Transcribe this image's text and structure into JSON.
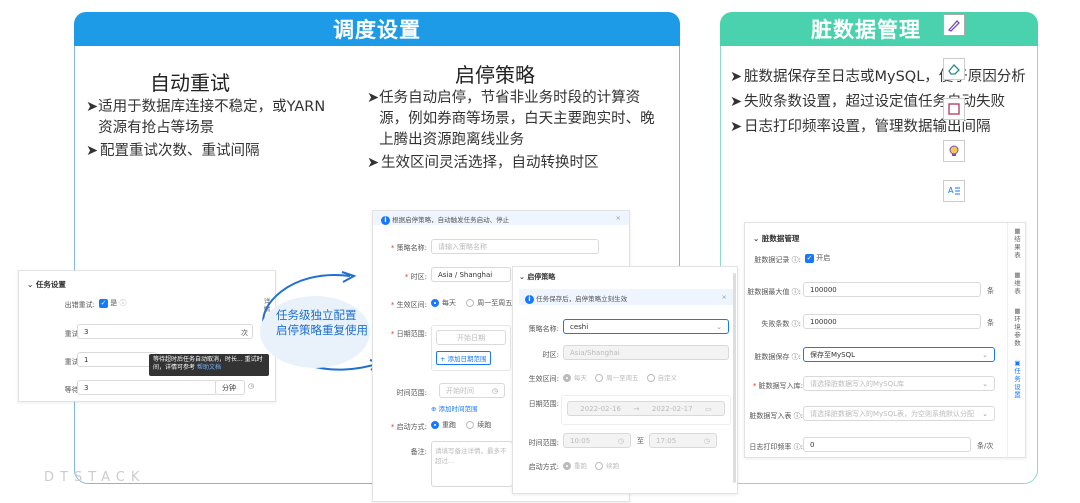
{
  "left_panel": {
    "title": "调度设置",
    "retry": {
      "title": "自动重试",
      "bullets": [
        "适用于数据库连接不稳定，或YARN资源有抢占等场景",
        "配置重试次数、重试间隔"
      ]
    },
    "startstop": {
      "title": "启停策略",
      "bullets": [
        "任务自动启停，节省非业务时段的计算资源，例如券商等场景，白天主要跑实时、晚上腾出资源跑离线业务",
        "生效区间灵活选择，自动转换时区"
      ]
    }
  },
  "right_panel": {
    "title": "脏数据管理",
    "bullets": [
      "脏数据保存至日志或MySQL，便于原因分析",
      "失败条数设置，超过设定值任务自动失败",
      "日志打印频率设置，管理数据输出间隔"
    ]
  },
  "callout": {
    "line1": "任务级独立配置",
    "line2": "启停策略重复使用"
  },
  "watermark": "DTSTACK",
  "task_settings": {
    "title": "任务设置",
    "retry_label": "出错重试:",
    "retry_value": "是",
    "count_label": "重试次数:",
    "count_value": "3",
    "count_unit": "次",
    "interval_label": "重试间隔:",
    "interval_value": "1",
    "timeout_label": "等待超时:",
    "timeout_value": "3",
    "timeout_unit": "分钟",
    "tooltip": "等待超时后任务自动取消，时长... 重试时间，详情可参考",
    "tooltip_link": "帮助文档",
    "side_tabs": [
      "详情"
    ]
  },
  "policy_form": {
    "banner": "根据启停策略，自动触发任务启动、停止",
    "name_label": "策略名称:",
    "name_placeholder": "请输入策略名称",
    "tz_label": "时区:",
    "tz_value": "Asia / Shanghai",
    "range_label": "生效区间:",
    "range_opt1": "每天",
    "range_opt2": "周一至周五",
    "date_label": "日期范围:",
    "date_start": "开始日期",
    "add_date": "+ 添加日期范围",
    "time_label": "时间范围:",
    "time_start": "开始时间",
    "add_time": "添加时间范围",
    "mode_label": "启动方式:",
    "mode_opt1": "重跑",
    "mode_opt2": "续跑",
    "note_label": "备注:",
    "note_placeholder": "请填写备注详情，最多不超过..."
  },
  "policy_popup": {
    "title": "启停策略",
    "banner": "任务保存后，启停策略立刻生效",
    "name_label": "策略名称:",
    "name_value": "ceshi",
    "tz_label": "时区:",
    "tz_value": "Asia/Shanghai",
    "range_label": "生效区间:",
    "range_opts": [
      "每天",
      "周一至周五",
      "自定义"
    ],
    "date_label": "日期范围:",
    "date_start": "2022-02-16",
    "date_sep": "→",
    "date_end": "2022-02-17",
    "time_label": "时间范围:",
    "time_start": "10:05",
    "time_sep": "至",
    "time_end": "17:05",
    "mode_label": "启动方式:",
    "mode_opts": [
      "重跑",
      "续跑"
    ]
  },
  "dirty_form": {
    "title": "脏数据管理",
    "record_label": "脏数据记录",
    "record_value": "开启",
    "max_label": "脏数据最大值",
    "max_value": "100000",
    "max_unit": "条",
    "fail_label": "失败条数",
    "fail_value": "100000",
    "fail_unit": "条",
    "save_label": "脏数据保存",
    "save_value": "保存至MySQL",
    "db_label": "脏数据写入库:",
    "db_placeholder": "请选择脏数据写入的MySQL库",
    "table_label": "脏数据写入表",
    "table_placeholder": "请选择脏数据写入的MySQL表，为空则系统默认分配",
    "freq_label": "日志打印频率",
    "freq_value": "0",
    "freq_unit": "条/次",
    "side_tabs": [
      "结果表",
      "维表",
      "环境参数",
      "任务设置"
    ]
  }
}
